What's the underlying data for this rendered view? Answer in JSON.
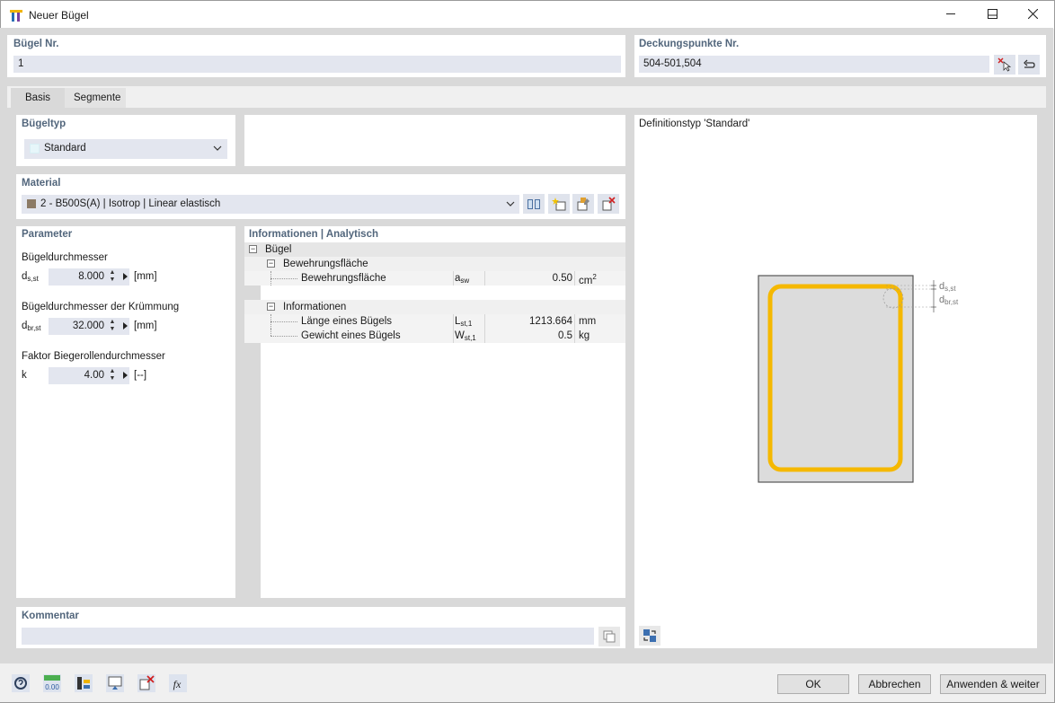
{
  "window": {
    "title": "Neuer Bügel"
  },
  "buegel_nr": {
    "label": "Bügel Nr.",
    "value": "1"
  },
  "deckungspunkte": {
    "label": "Deckungspunkte Nr.",
    "value": "504-501,504"
  },
  "tabs": [
    {
      "label": "Basis"
    },
    {
      "label": "Segmente"
    }
  ],
  "buegeltyp": {
    "label": "Bügeltyp",
    "value": "Standard"
  },
  "material": {
    "label": "Material",
    "value": "2 - B500S(A) | Isotrop | Linear elastisch",
    "swatch_color": "#8c7b66"
  },
  "parameter": {
    "label": "Parameter",
    "items": [
      {
        "title": "Bügeldurchmesser",
        "sym": "d",
        "sub": "s,st",
        "value": "8.000",
        "unit": "[mm]"
      },
      {
        "title": "Bügeldurchmesser der Krümmung",
        "sym": "d",
        "sub": "br,st",
        "value": "32.000",
        "unit": "[mm]"
      },
      {
        "title": "Faktor Biegerollendurchmesser",
        "sym": "k",
        "sub": "",
        "value": "4.00",
        "unit": "[--]"
      }
    ]
  },
  "info": {
    "label": "Informationen | Analytisch",
    "root": "Bügel",
    "groups": [
      {
        "name": "Bewehrungsfläche",
        "rows": [
          {
            "name": "Bewehrungsfläche",
            "sym": "a",
            "sub": "sw",
            "value": "0.50",
            "unit": "cm",
            "unit_sup": "2"
          }
        ]
      },
      {
        "name": "Informationen",
        "rows": [
          {
            "name": "Länge eines Bügels",
            "sym": "L",
            "sub": "st,1",
            "value": "1213.664",
            "unit": "mm",
            "unit_sup": ""
          },
          {
            "name": "Gewicht eines Bügels",
            "sym": "W",
            "sub": "st,1",
            "value": "0.5",
            "unit": "kg",
            "unit_sup": ""
          }
        ]
      }
    ]
  },
  "preview": {
    "title": "Definitionstyp 'Standard'",
    "label_ds": {
      "sym": "d",
      "sub": "s,st"
    },
    "label_dbr": {
      "sym": "d",
      "sub": "br,st"
    },
    "stirrup_color": "#f5b800",
    "section_color": "#dcdcdc"
  },
  "kommentar": {
    "label": "Kommentar",
    "value": ""
  },
  "buttons": {
    "ok": "OK",
    "cancel": "Abbrechen",
    "apply": "Anwenden & weiter"
  },
  "footer_icons": [
    "help-icon",
    "units-icon",
    "display-icon",
    "view-icon",
    "delete-icon",
    "formula-icon"
  ]
}
